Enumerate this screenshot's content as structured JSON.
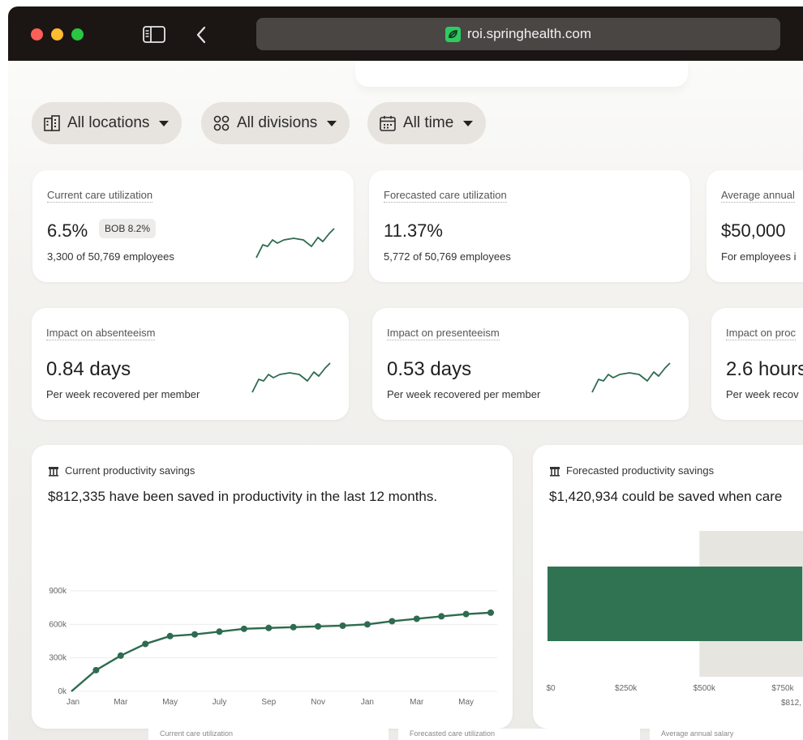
{
  "browser": {
    "url": "roi.springhealth.com"
  },
  "filters": [
    {
      "label": "All locations",
      "icon": "building-icon"
    },
    {
      "label": "All divisions",
      "icon": "org-chart-icon"
    },
    {
      "label": "All time",
      "icon": "calendar-icon"
    }
  ],
  "metrics_row1": [
    {
      "label": "Current care utilization",
      "value": "6.5%",
      "badge": "BOB 8.2%",
      "sub": "3,300 of 50,769 employees"
    },
    {
      "label": "Forecasted care utilization",
      "value": "11.37%",
      "sub": "5,772 of 50,769 employees"
    },
    {
      "label": "Average annual",
      "value": "$50,000",
      "sub": "For employees i"
    }
  ],
  "metrics_row2": [
    {
      "label": "Impact on absenteeism",
      "value": "0.84 days",
      "sub": "Per week recovered per member"
    },
    {
      "label": "Impact on presenteeism",
      "value": "0.53 days",
      "sub": "Per week recovered per member"
    },
    {
      "label": "Impact on proc",
      "value": "2.6 hours",
      "sub": "Per week recov"
    }
  ],
  "current_savings": {
    "title": "Current productivity savings",
    "headline": "$812,335 have been saved in productivity in the last 12 months."
  },
  "forecast_savings": {
    "title": "Forecasted productivity savings",
    "headline": "$1,420,934 could be saved when care"
  },
  "bottom_tabs": [
    "Current care utilization",
    "Forecasted care utilization",
    "Average annual salary"
  ],
  "colors": {
    "accent": "#2e6b4f",
    "bar": "#2f7353",
    "card": "#ffffff",
    "background": "#f3f2ef"
  },
  "chart_data": [
    {
      "type": "line",
      "x": [
        "Jan",
        "Feb",
        "Mar",
        "Apr",
        "May",
        "Jun",
        "July",
        "Aug",
        "Sep",
        "Oct",
        "Nov",
        "Dec",
        "Jan",
        "Feb",
        "Mar",
        "Apr",
        "May",
        "Jun"
      ],
      "x_tick_labels": [
        "Jan",
        "Mar",
        "May",
        "July",
        "Sep",
        "Nov",
        "Jan",
        "Mar",
        "May"
      ],
      "values": [
        0,
        190000,
        320000,
        425000,
        495000,
        510000,
        535000,
        560000,
        568000,
        575000,
        582000,
        588000,
        600000,
        628000,
        650000,
        672000,
        692000,
        705000
      ],
      "y_ticks": [
        "0k",
        "300k",
        "600k",
        "900k"
      ],
      "ylim": [
        0,
        900000
      ],
      "grid": true
    },
    {
      "type": "bar",
      "orientation": "horizontal",
      "categories": [
        ""
      ],
      "values": [
        812335
      ],
      "x_ticks": [
        "$0",
        "$250k",
        "$500k",
        "$750k"
      ],
      "annotation": "$812,",
      "xlim": [
        0,
        900000
      ]
    }
  ]
}
